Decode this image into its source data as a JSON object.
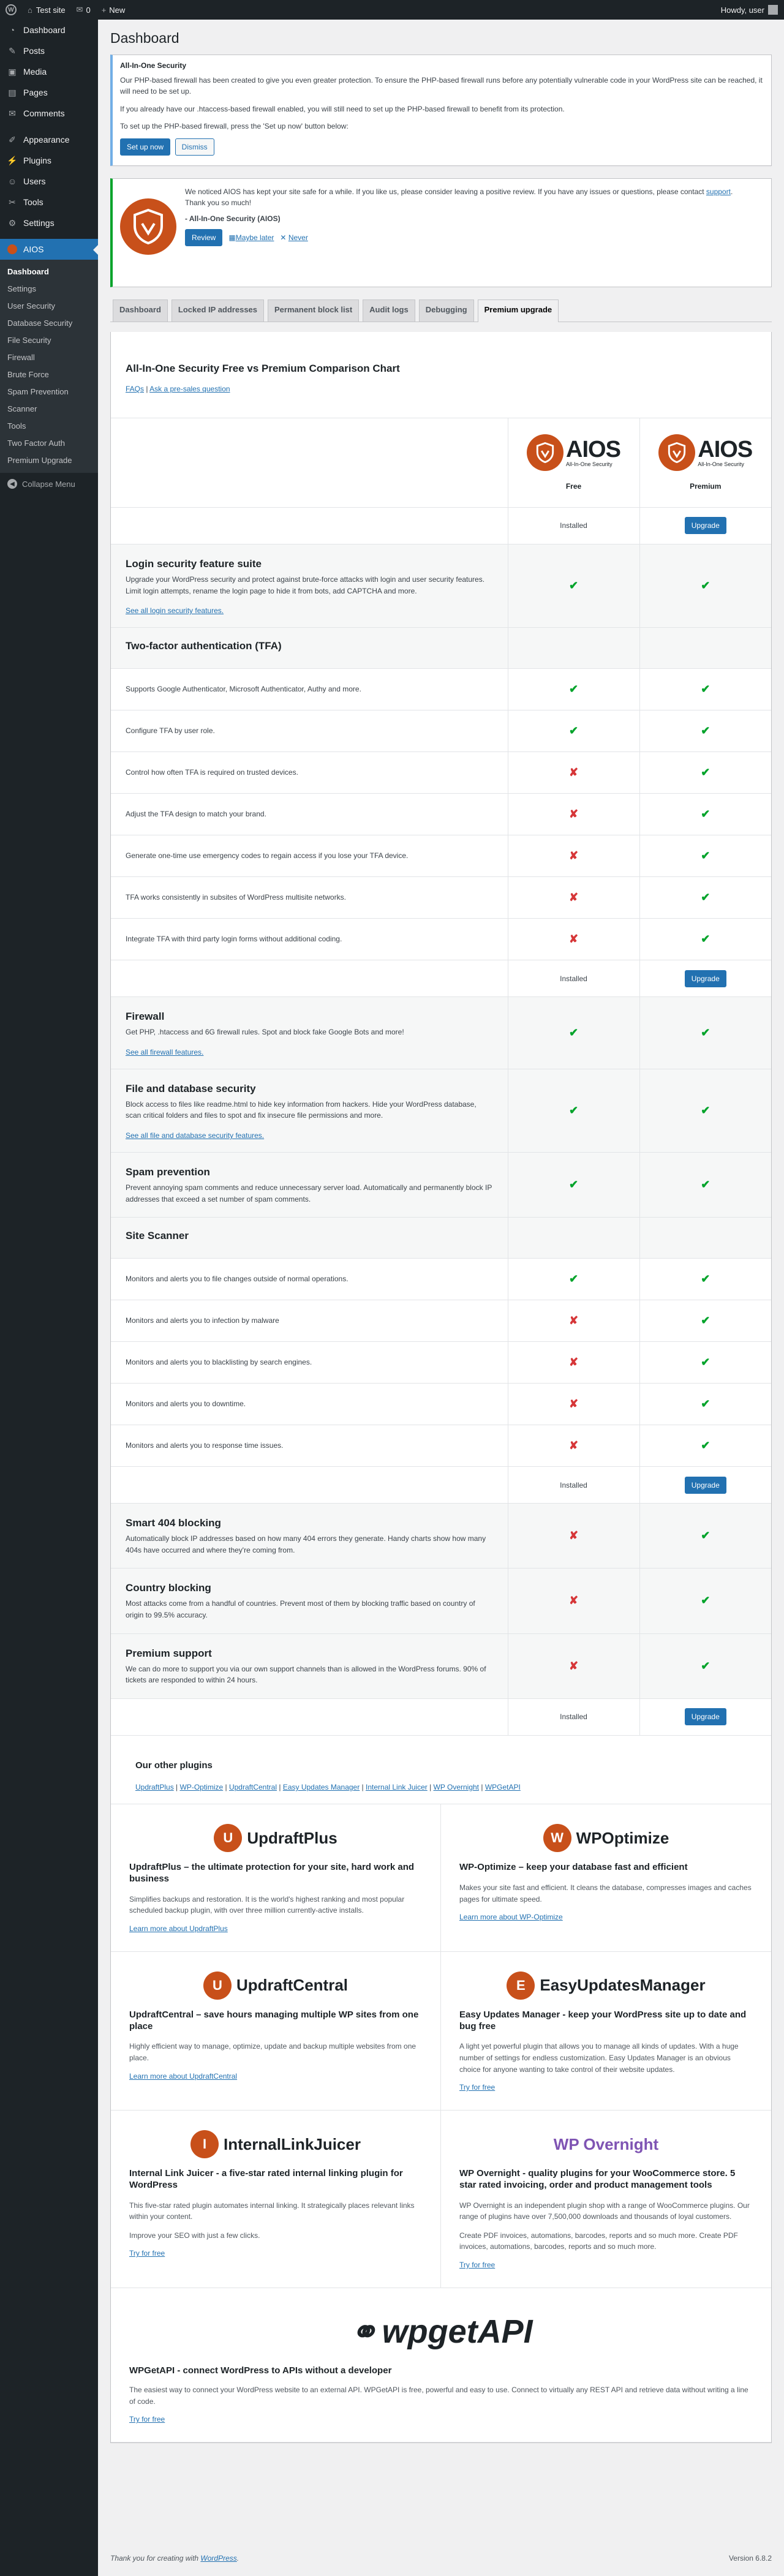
{
  "adminbar": {
    "site": "Test site",
    "comments": "0",
    "new": "New",
    "howdy": "Howdy, user"
  },
  "sidebar": {
    "items": [
      {
        "label": "Dashboard",
        "icon": "dashboard-icon",
        "glyph": "◔"
      },
      {
        "label": "Posts",
        "icon": "pin-icon",
        "glyph": "✎"
      },
      {
        "label": "Media",
        "icon": "media-icon",
        "glyph": "▣"
      },
      {
        "label": "Pages",
        "icon": "page-icon",
        "glyph": "▤"
      },
      {
        "label": "Comments",
        "icon": "comment-icon",
        "glyph": "✉"
      },
      {
        "label": "Appearance",
        "icon": "brush-icon",
        "glyph": "✐"
      },
      {
        "label": "Plugins",
        "icon": "plug-icon",
        "glyph": "⚡"
      },
      {
        "label": "Users",
        "icon": "user-icon",
        "glyph": "☺"
      },
      {
        "label": "Tools",
        "icon": "wrench-icon",
        "glyph": "✂"
      },
      {
        "label": "Settings",
        "icon": "settings-icon",
        "glyph": "⚙"
      }
    ],
    "aios": "AIOS",
    "sub": [
      "Dashboard",
      "Settings",
      "User Security",
      "Database Security",
      "File Security",
      "Firewall",
      "Brute Force",
      "Spam Prevention",
      "Scanner",
      "Tools",
      "Two Factor Auth",
      "Premium Upgrade"
    ],
    "collapse": "Collapse Menu"
  },
  "page_title": "Dashboard",
  "notice": {
    "title": "All-In-One Security",
    "p1": "Our PHP-based firewall has been created to give you even greater protection. To ensure the PHP-based firewall runs before any potentially vulnerable code in your WordPress site can be reached, it will need to be set up.",
    "p2": "If you already have our .htaccess-based firewall enabled, you will still need to set up the PHP-based firewall to benefit from its protection.",
    "p3": "To set up the PHP-based firewall, press the 'Set up now' button below:",
    "setup": "Set up now",
    "dismiss": "Dismiss"
  },
  "review": {
    "p1_a": "We noticed AIOS has kept your site safe for a while. If you like us, please consider leaving a positive review. If you have any issues or questions, please contact ",
    "support": "support",
    "p1_b": ".",
    "thanks": "Thank you so much!",
    "sign": "- All-In-One Security (AIOS)",
    "review_btn": "Review",
    "later": "Maybe later",
    "never": "Never"
  },
  "tabs": [
    "Dashboard",
    "Locked IP addresses",
    "Permanent block list",
    "Audit logs",
    "Debugging",
    "Premium upgrade"
  ],
  "chart_title": "All-In-One Security Free vs Premium Comparison Chart",
  "faqs": "FAQs",
  "presale": "Ask a pre-sales question",
  "plans": {
    "free": "Free",
    "premium": "Premium",
    "logo_text": "AIOS",
    "logo_sub": "All-In-One Security",
    "installed": "Installed",
    "upgrade": "Upgrade"
  },
  "rows": [
    {
      "type": "feature",
      "title": "Login security feature suite",
      "desc": "Upgrade your WordPress security and protect against brute-force attacks with login and user security features. Limit login attempts, rename the login page to hide it from bots, add CAPTCHA and more.",
      "link": "See all login security features.",
      "free": true,
      "premium": true,
      "grey": true
    },
    {
      "type": "heading",
      "title": "Two-factor authentication (TFA)",
      "grey": true
    },
    {
      "type": "item",
      "desc": "Supports Google Authenticator, Microsoft Authenticator, Authy and more.",
      "free": true,
      "premium": true
    },
    {
      "type": "item",
      "desc": "Configure TFA by user role.",
      "free": true,
      "premium": true
    },
    {
      "type": "item",
      "desc": "Control how often TFA is required on trusted devices.",
      "free": false,
      "premium": true
    },
    {
      "type": "item",
      "desc": "Adjust the TFA design to match your brand.",
      "free": false,
      "premium": true
    },
    {
      "type": "item",
      "desc": "Generate one-time use emergency codes to regain access if you lose your TFA device.",
      "free": false,
      "premium": true
    },
    {
      "type": "item",
      "desc": "TFA works consistently in subsites of WordPress multisite networks.",
      "free": false,
      "premium": true
    },
    {
      "type": "item",
      "desc": "Integrate TFA with third party login forms without additional coding.",
      "free": false,
      "premium": true
    },
    {
      "type": "install"
    },
    {
      "type": "feature",
      "title": "Firewall",
      "desc": "Get PHP, .htaccess and 6G firewall rules. Spot and block fake Google Bots and more!",
      "link": "See all firewall features.",
      "free": true,
      "premium": true,
      "grey": true
    },
    {
      "type": "feature",
      "title": "File and database security",
      "desc": "Block access to files like readme.html to hide key information from hackers. Hide your WordPress database, scan critical folders and files to spot and fix insecure file permissions and more.",
      "link": "See all file and database security features.",
      "free": true,
      "premium": true,
      "grey": true
    },
    {
      "type": "feature",
      "title": "Spam prevention",
      "desc": "Prevent annoying spam comments and reduce unnecessary server load. Automatically and permanently block IP addresses that exceed a set number of spam comments.",
      "free": true,
      "premium": true,
      "grey": true
    },
    {
      "type": "heading",
      "title": "Site Scanner",
      "grey": true
    },
    {
      "type": "item",
      "desc": "Monitors and alerts you to file changes outside of normal operations.",
      "free": true,
      "premium": true
    },
    {
      "type": "item",
      "desc": "Monitors and alerts you to infection by malware",
      "free": false,
      "premium": true
    },
    {
      "type": "item",
      "desc": "Monitors and alerts you to blacklisting by search engines.",
      "free": false,
      "premium": true
    },
    {
      "type": "item",
      "desc": "Monitors and alerts you to downtime.",
      "free": false,
      "premium": true
    },
    {
      "type": "item",
      "desc": "Monitors and alerts you to response time issues.",
      "free": false,
      "premium": true
    },
    {
      "type": "install"
    },
    {
      "type": "feature",
      "title": "Smart 404 blocking",
      "desc": "Automatically block IP addresses based on how many 404 errors they generate. Handy charts show how many 404s have occurred and where they're coming from.",
      "free": false,
      "premium": true,
      "grey": true
    },
    {
      "type": "feature",
      "title": "Country blocking",
      "desc": "Most attacks come from a handful of countries. Prevent most of them by blocking traffic based on country of origin to 99.5% accuracy.",
      "free": false,
      "premium": true,
      "grey": true
    },
    {
      "type": "feature",
      "title": "Premium support",
      "desc": "We can do more to support you via our own support channels than is allowed in the WordPress forums. 90% of tickets are responded to within 24 hours.",
      "free": false,
      "premium": true,
      "grey": true
    },
    {
      "type": "install"
    }
  ],
  "other": {
    "title": "Our other plugins",
    "links": [
      "UpdraftPlus",
      "WP-Optimize",
      "UpdraftCentral",
      "Easy Updates Manager",
      "Internal Link Juicer",
      "WP Overnight",
      "WPGetAPI"
    ]
  },
  "plugins": [
    {
      "logo": "UpdraftPlus",
      "mark": "U",
      "color": "#c8501a",
      "title": "UpdraftPlus – the ultimate protection for your site, hard work and business",
      "paras": [
        "Simplifies backups and restoration. It is the world's highest ranking and most popular scheduled backup plugin, with over three million currently-active installs."
      ],
      "link": "Learn more about UpdraftPlus"
    },
    {
      "logo": "WPOptimize",
      "mark": "W",
      "color": "#c8501a",
      "title": "WP-Optimize – keep your database fast and efficient",
      "paras": [
        "Makes your site fast and efficient. It cleans the database, compresses images and caches pages for ultimate speed."
      ],
      "link": "Learn more about WP-Optimize"
    },
    {
      "logo": "UpdraftCentral",
      "mark": "U",
      "color": "#c8501a",
      "title": "UpdraftCentral – save hours managing multiple WP sites from one place",
      "paras": [
        "Highly efficient way to manage, optimize, update and backup multiple websites from one place."
      ],
      "link": "Learn more about UpdraftCentral"
    },
    {
      "logo": "EasyUpdatesManager",
      "mark": "E",
      "color": "#c8501a",
      "title": "Easy Updates Manager - keep your WordPress site up to date and bug free",
      "paras": [
        "A light yet powerful plugin that allows you to manage all kinds of updates. With a huge number of settings for endless customization. Easy Updates Manager is an obvious choice for anyone wanting to take control of their website updates."
      ],
      "link": "Try for free"
    },
    {
      "logo": "InternalLinkJuicer",
      "mark": "I",
      "color": "#c8501a",
      "title": "Internal Link Juicer - a five-star rated internal linking plugin for WordPress",
      "paras": [
        "This five-star rated plugin automates internal linking. It strategically places relevant links within your content.",
        "Improve your SEO with just a few clicks."
      ],
      "link": "Try for free"
    },
    {
      "logo": "WP Overnight",
      "mark": "",
      "color": "#7f54b3",
      "title": "WP Overnight - quality plugins for your WooCommerce store. 5 star rated invoicing, order and product management tools",
      "paras": [
        "WP Overnight is an independent plugin shop with a range of WooCommerce plugins. Our range of plugins have over 7,500,000 downloads and thousands of loyal customers.",
        "Create PDF invoices, automations, barcodes, reports and so much more. Create PDF invoices, automations, barcodes, reports and so much more."
      ],
      "link": "Try for free"
    }
  ],
  "wpgetapi": {
    "logo": "wpgetAPI",
    "title": "WPGetAPI - connect WordPress to APIs without a developer",
    "para": "The easiest way to connect your WordPress website to an external API. WPGetAPI is free, powerful and easy to use. Connect to virtually any REST API and retrieve data without writing a line of code.",
    "link": "Try for free"
  },
  "footer": {
    "thanks": "Thank you for creating with ",
    "wp": "WordPress",
    "dot": ".",
    "version": "Version 6.8.2"
  },
  "colors": {
    "accent": "#2271b1",
    "aios": "#c8501a",
    "yes": "#00a32a",
    "no": "#d63638"
  }
}
